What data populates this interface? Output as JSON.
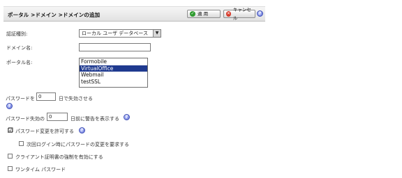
{
  "header": {
    "breadcrumb": "ポータル >ドメイン >ドメインの追加",
    "apply_label": "適 用",
    "cancel_label": "キャンセル"
  },
  "form": {
    "auth_type_label": "認証種別:",
    "auth_type_value": "ローカル ユーザ データベース",
    "domain_name_label": "ドメイン名:",
    "domain_name_value": "",
    "portal_name_label": "ポータル名:",
    "portal_options": [
      "Formobile",
      "VirtualOffice",
      "Webmail",
      "testSSL"
    ],
    "portal_selected": "VirtualOffice",
    "pw_expire_prefix": "パスワードを",
    "pw_expire_value": "0",
    "pw_expire_suffix": "日で失効させる",
    "pw_warn_prefix": "パスワード失効の",
    "pw_warn_value": "0",
    "pw_warn_suffix": "日前に警告を表示する",
    "allow_pw_change_label": "パスワード変更を許可する",
    "allow_pw_change_checked": "☑",
    "require_pw_change_label": "次回ログイン時にパスワードの変更を要求する",
    "client_cert_label": "クライアント証明書の強制を有効にする",
    "one_time_pw_label": "ワンタイム パスワード"
  },
  "icons": {
    "help": "help-icon",
    "apply": "check-icon",
    "cancel": "cancel-icon"
  },
  "colors": {
    "selection": "#1f3a8f",
    "apply_icon": "#2e9b2e",
    "cancel_icon": "#d63a2a"
  }
}
